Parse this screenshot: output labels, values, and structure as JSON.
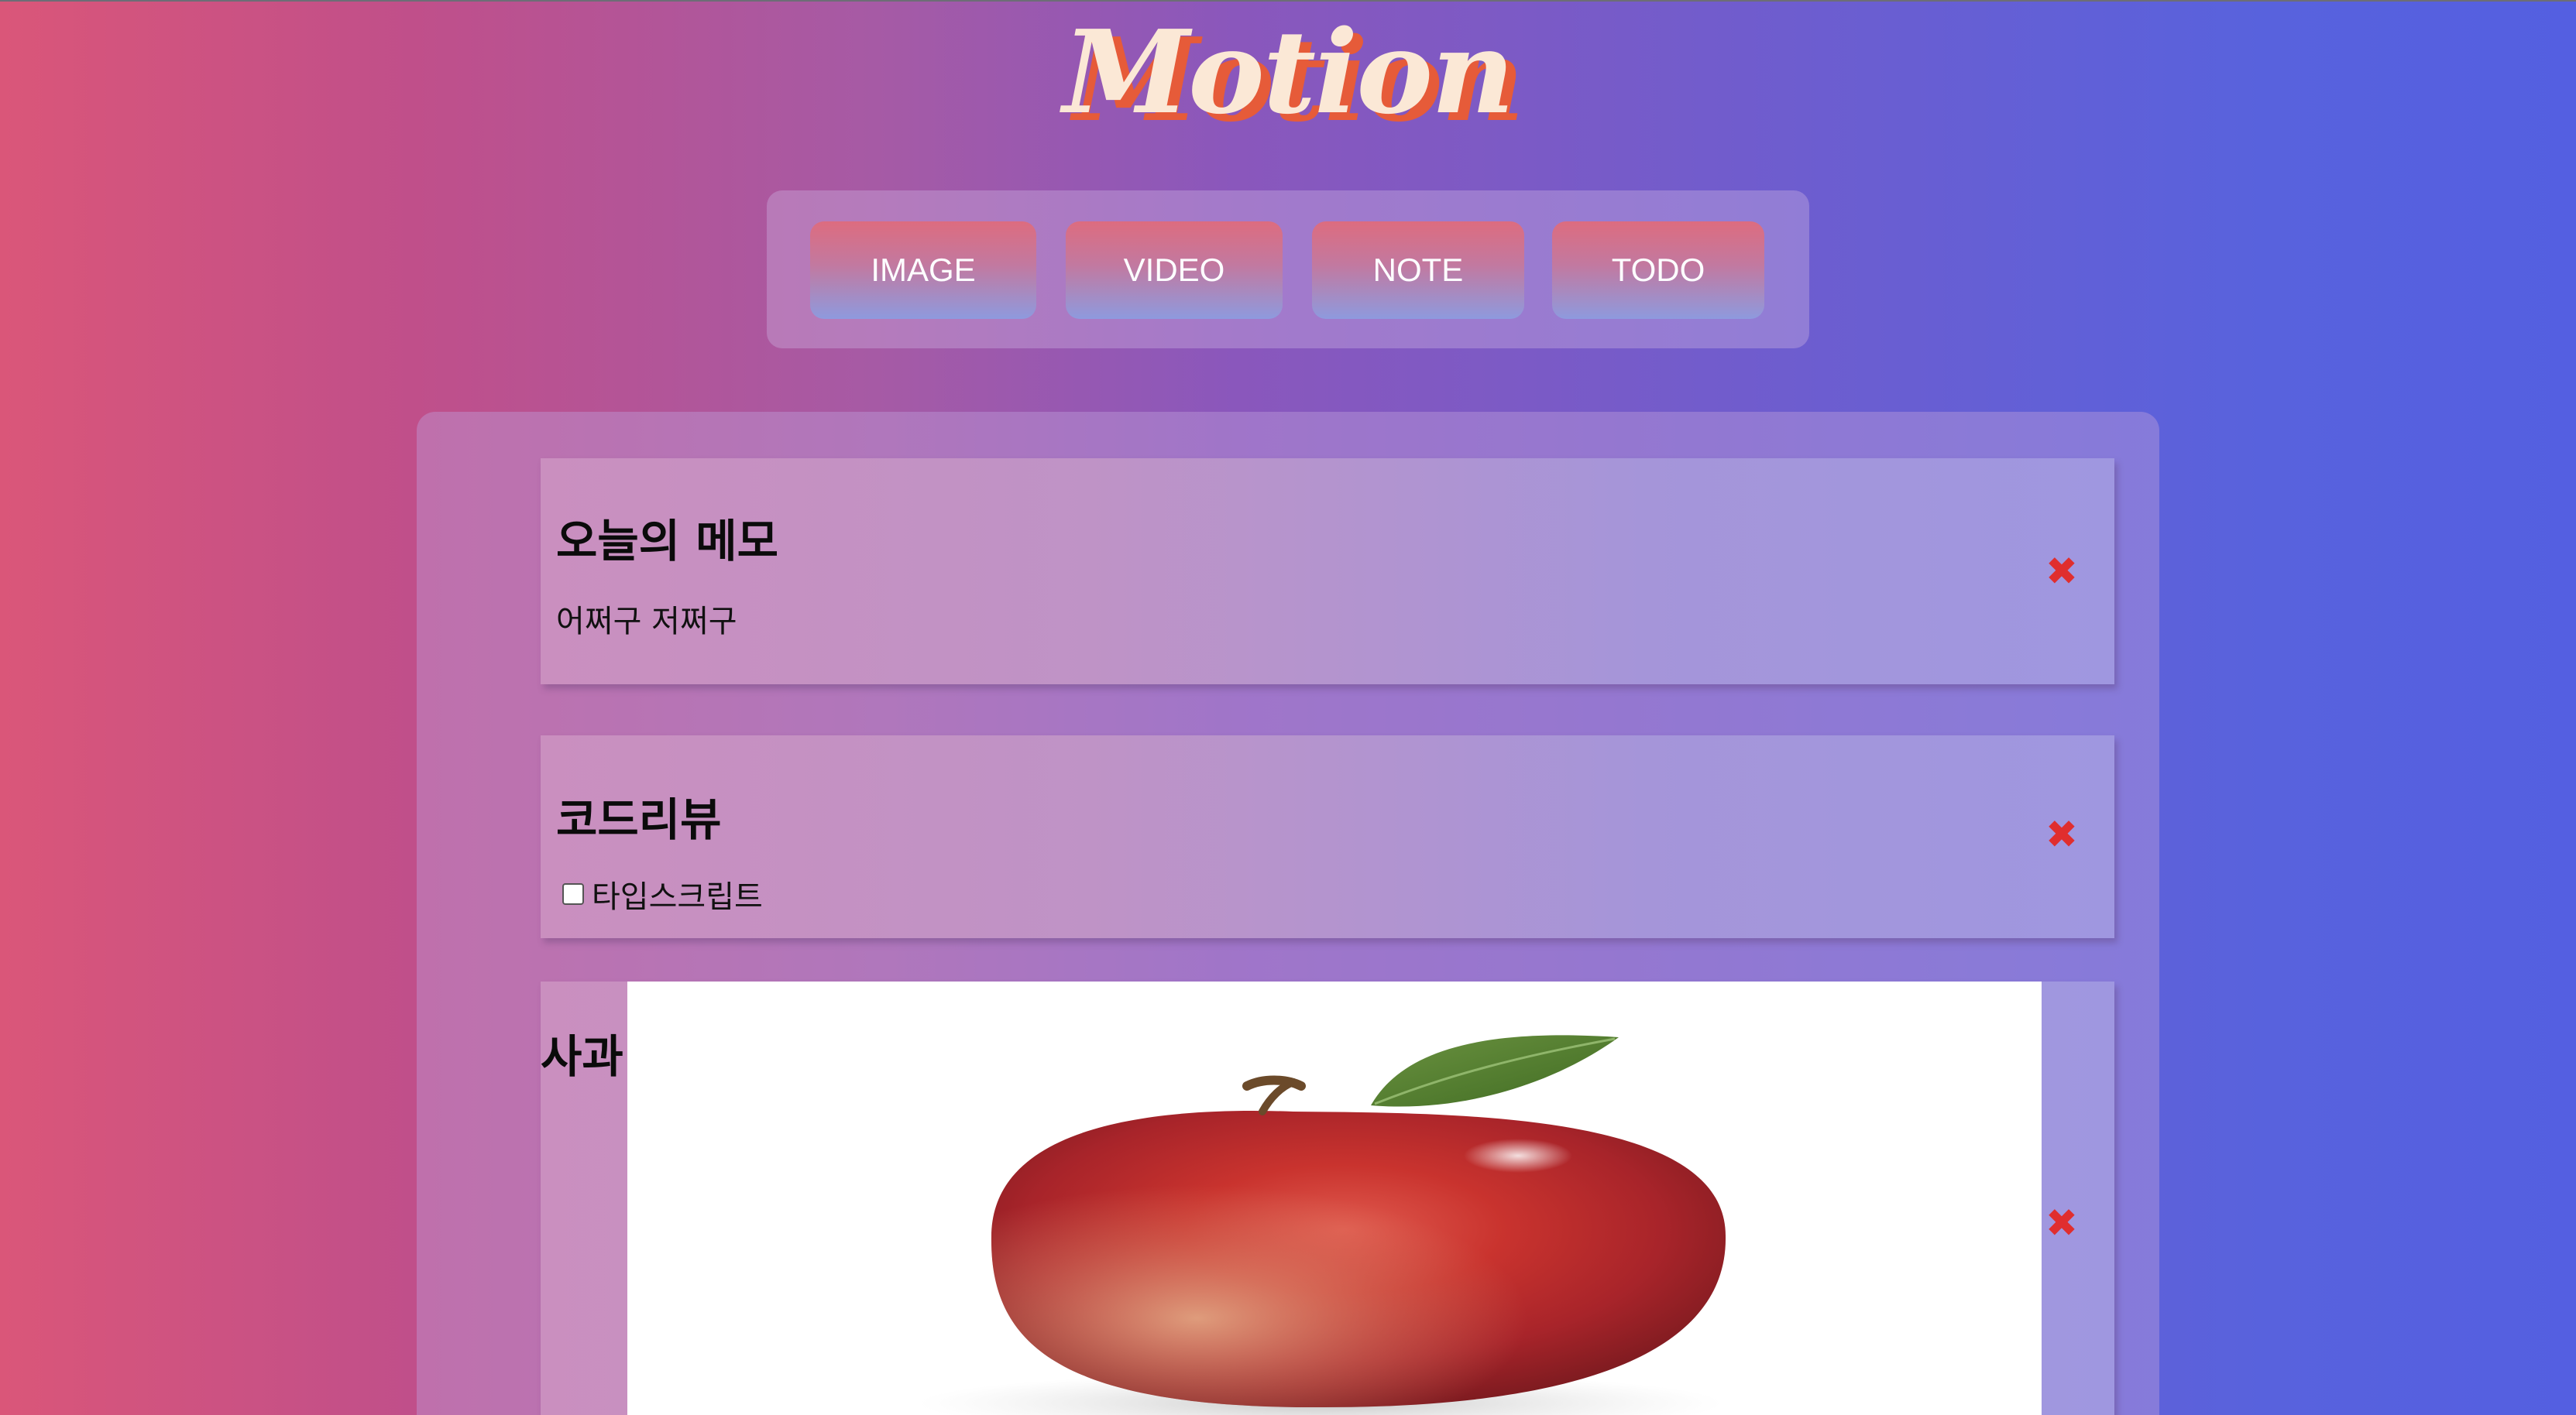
{
  "app": {
    "logo": "Motion"
  },
  "controls": {
    "image_label": "IMAGE",
    "video_label": "VIDEO",
    "note_label": "NOTE",
    "todo_label": "TODO"
  },
  "items": {
    "note": {
      "title": "오늘의 메모",
      "body": "어쩌구 저쩌구",
      "close_label": "✖"
    },
    "todo": {
      "title": "코드리뷰",
      "task": "타입스크립트",
      "checked": false,
      "close_label": "✖"
    },
    "image": {
      "title": "사과",
      "image_subject": "apple",
      "close_label": "✖"
    }
  },
  "colors": {
    "gradient_start": "#da5679",
    "gradient_end": "#545fe1",
    "logo_text": "#fbe8d6",
    "logo_shadow": "#e65b39",
    "close_icon": "#e02e2e"
  },
  "icons": {
    "close": "close-icon",
    "checkbox": "checkbox-icon"
  }
}
